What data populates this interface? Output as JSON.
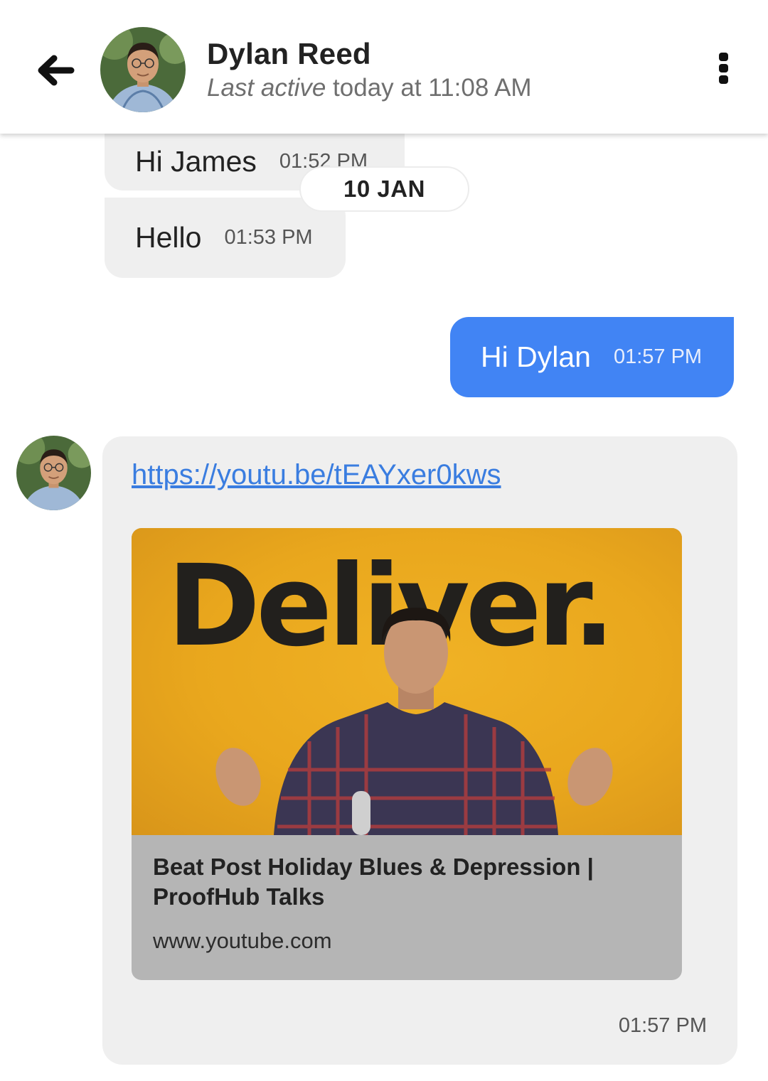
{
  "header": {
    "contact_name": "Dylan Reed",
    "last_active_prefix": "Last active",
    "last_active_rest": "today at 11:08 AM",
    "back_icon": "arrow-left-icon",
    "more_icon": "more-vertical-icon"
  },
  "messages": [
    {
      "direction": "incoming",
      "text": "Hi James",
      "time": "01:52 PM"
    },
    {
      "direction": "incoming",
      "text": "Hello",
      "time": "01:53 PM"
    },
    {
      "direction": "outgoing",
      "text": "Hi Dylan",
      "time": "01:57 PM"
    }
  ],
  "date_separator": "10 JAN",
  "link_message": {
    "url": "https://youtu.be/tEAYxer0kws",
    "preview": {
      "thumbnail_text": "Deliver.",
      "title": "Beat Post Holiday Blues & Depression | ProofHub Talks",
      "domain": "www.youtube.com"
    },
    "time": "01:57 PM"
  },
  "colors": {
    "outgoing_bubble": "#4184f4",
    "incoming_bubble": "#efefef",
    "link": "#3a7de0",
    "thumbnail_bg": "#e9a71d"
  }
}
